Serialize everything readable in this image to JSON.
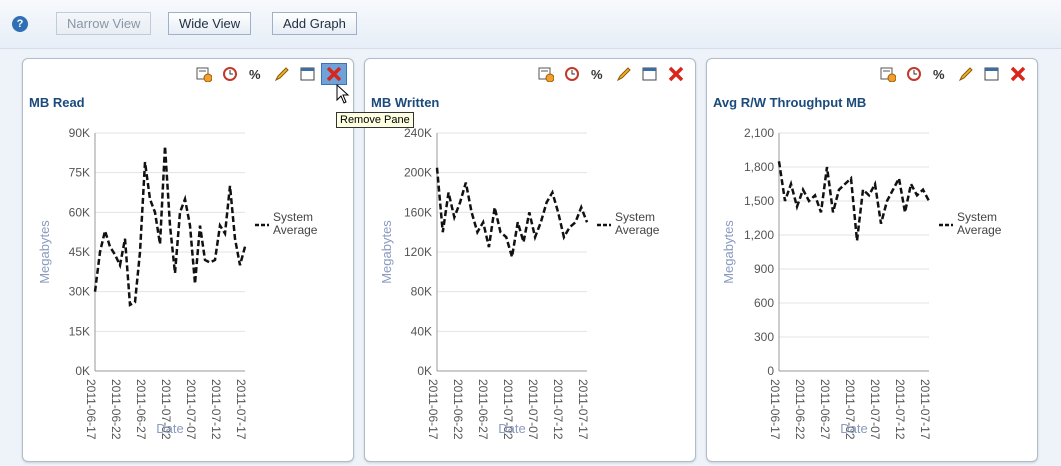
{
  "toolbar": {
    "help_icon": "?",
    "narrow_view": "Narrow View",
    "wide_view": "Wide View",
    "add_graph": "Add Graph"
  },
  "tooltip": "Remove Pane",
  "panes": [
    {
      "title": "MB Read",
      "chart_data": {
        "type": "line",
        "title": "MB Read",
        "xlabel": "Date",
        "ylabel": "Megabytes",
        "yticks": [
          "0K",
          "15K",
          "30K",
          "45K",
          "60K",
          "75K",
          "90K"
        ],
        "ylim": [
          0,
          90000
        ],
        "xticks": [
          "2011-06-17",
          "2011-06-22",
          "2011-06-27",
          "2011-07-02",
          "2011-07-07",
          "2011-07-12",
          "2011-07-17"
        ],
        "series": [
          {
            "name": "System Average",
            "style": "dashed",
            "color": "#111111",
            "values": [
              30000,
              45000,
              53000,
              47000,
              44000,
              40000,
              50000,
              25000,
              26000,
              45000,
              79000,
              65000,
              60000,
              48000,
              85000,
              55000,
              37000,
              60000,
              65000,
              55000,
              33000,
              55000,
              42000,
              41000,
              42000,
              55000,
              52000,
              70000,
              50000,
              40000,
              47000
            ]
          }
        ],
        "legend": "System Average"
      }
    },
    {
      "title": "MB Written",
      "chart_data": {
        "type": "line",
        "title": "MB Written",
        "xlabel": "Date",
        "ylabel": "Megabytes",
        "yticks": [
          "0K",
          "40K",
          "80K",
          "120K",
          "160K",
          "200K",
          "240K"
        ],
        "ylim": [
          0,
          240000
        ],
        "xticks": [
          "2011-06-17",
          "2011-06-22",
          "2011-06-27",
          "2011-07-02",
          "2011-07-07",
          "2011-07-12",
          "2011-07-17"
        ],
        "series": [
          {
            "name": "System Average",
            "style": "dashed",
            "color": "#111111",
            "values": [
              205000,
              140000,
              180000,
              155000,
              170000,
              190000,
              160000,
              140000,
              150000,
              125000,
              165000,
              140000,
              135000,
              115000,
              150000,
              130000,
              160000,
              135000,
              150000,
              170000,
              180000,
              160000,
              135000,
              145000,
              150000,
              165000,
              150000
            ]
          }
        ],
        "legend": "System Average"
      }
    },
    {
      "title": "Avg R/W Throughput MB",
      "chart_data": {
        "type": "line",
        "title": "Avg R/W Throughput MB",
        "xlabel": "Date",
        "ylabel": "Megabytes",
        "yticks": [
          "0",
          "300",
          "600",
          "900",
          "1,200",
          "1,500",
          "1,800",
          "2,100"
        ],
        "ylim": [
          0,
          2100
        ],
        "xticks": [
          "2011-06-17",
          "2011-06-22",
          "2011-06-27",
          "2011-07-02",
          "2011-07-07",
          "2011-07-12",
          "2011-07-17"
        ],
        "series": [
          {
            "name": "System Average",
            "style": "dashed",
            "color": "#111111",
            "values": [
              1850,
              1500,
              1650,
              1450,
              1600,
              1500,
              1550,
              1400,
              1800,
              1400,
              1600,
              1650,
              1700,
              1150,
              1600,
              1550,
              1650,
              1300,
              1500,
              1600,
              1700,
              1400,
              1650,
              1550,
              1600,
              1500
            ]
          }
        ],
        "legend": "System Average"
      }
    }
  ]
}
